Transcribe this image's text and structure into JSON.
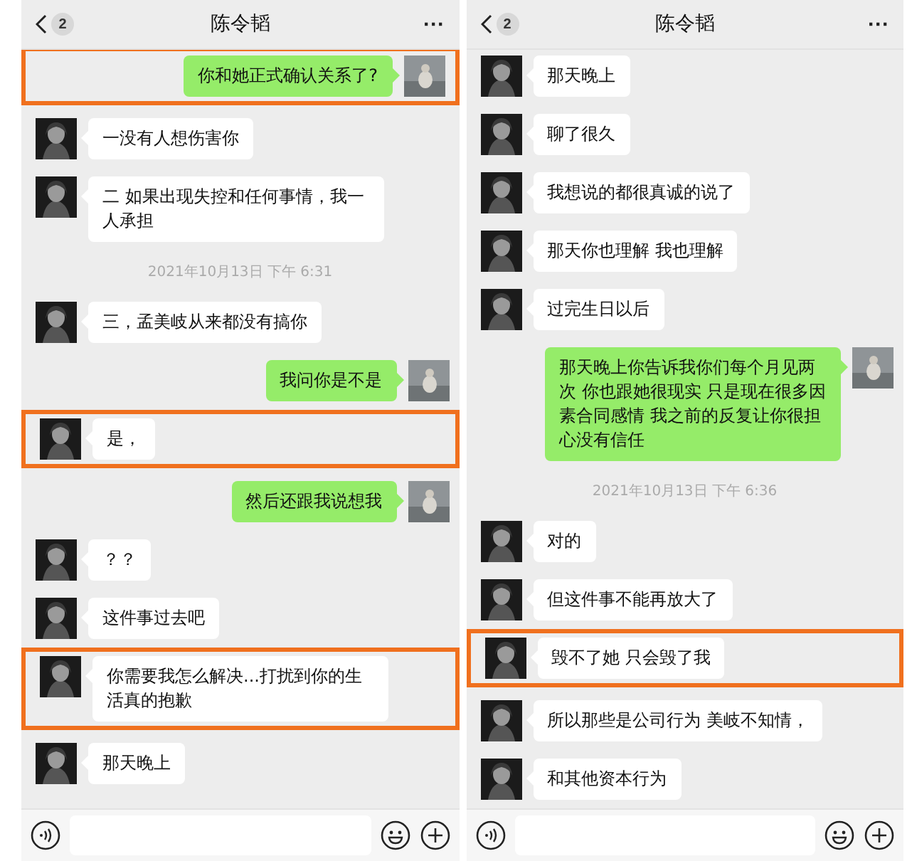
{
  "panels": [
    {
      "header": {
        "back_count": "2",
        "title": "陈令韬",
        "more": "···"
      },
      "messages": [
        {
          "kind": "out",
          "text": "你和她正式确认关系了?",
          "highlighted": true
        },
        {
          "kind": "in",
          "text": "一没有人想伤害你",
          "highlighted": false
        },
        {
          "kind": "in",
          "text": "二 如果出现失控和任何事情，我一人承担",
          "highlighted": false
        },
        {
          "kind": "time",
          "text": "2021年10月13日 下午 6:31"
        },
        {
          "kind": "in",
          "text": "三，孟美岐从来都没有搞你",
          "highlighted": false
        },
        {
          "kind": "out",
          "text": "我问你是不是",
          "highlighted": false
        },
        {
          "kind": "in",
          "text": "是，",
          "highlighted": true
        },
        {
          "kind": "out",
          "text": "然后还跟我说想我",
          "highlighted": false
        },
        {
          "kind": "in",
          "text": "？？",
          "highlighted": false
        },
        {
          "kind": "in",
          "text": "这件事过去吧",
          "highlighted": false
        },
        {
          "kind": "in",
          "text": "你需要我怎么解决...打扰到你的生活真的抱歉",
          "highlighted": true
        },
        {
          "kind": "in",
          "text": "那天晚上",
          "highlighted": false
        }
      ]
    },
    {
      "header": {
        "back_count": "2",
        "title": "陈令韬",
        "more": "···"
      },
      "messages": [
        {
          "kind": "in",
          "text": "那天晚上",
          "highlighted": false
        },
        {
          "kind": "in",
          "text": "聊了很久",
          "highlighted": false
        },
        {
          "kind": "in",
          "text": "我想说的都很真诚的说了",
          "highlighted": false
        },
        {
          "kind": "in",
          "text": "那天你也理解 我也理解",
          "highlighted": false
        },
        {
          "kind": "in",
          "text": "过完生日以后",
          "highlighted": false
        },
        {
          "kind": "out",
          "text": "那天晚上你告诉我你们每个月见两次 你也跟她很现实 只是现在很多因素合同感情 我之前的反复让你很担心没有信任",
          "highlighted": false
        },
        {
          "kind": "time",
          "text": "2021年10月13日 下午 6:36"
        },
        {
          "kind": "in",
          "text": "对的",
          "highlighted": false
        },
        {
          "kind": "in",
          "text": "但这件事不能再放大了",
          "highlighted": false
        },
        {
          "kind": "in",
          "text": "毁不了她 只会毁了我",
          "highlighted": true
        },
        {
          "kind": "in",
          "text": "所以那些是公司行为 美岐不知情，",
          "highlighted": false
        },
        {
          "kind": "in",
          "text": "和其他资本行为",
          "highlighted": false
        }
      ]
    }
  ]
}
